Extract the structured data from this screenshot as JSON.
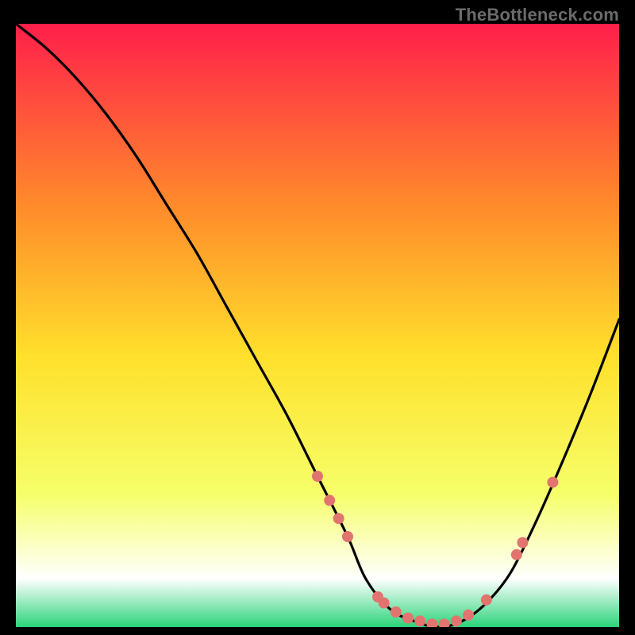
{
  "watermark": "TheBottleneck.com",
  "chart_data": {
    "type": "line",
    "title": "",
    "xlabel": "",
    "ylabel": "",
    "xlim": [
      0,
      100
    ],
    "ylim": [
      0,
      100
    ],
    "grid": false,
    "legend": false,
    "background_gradient": {
      "top": "#ff1f4b",
      "mid_upper": "#ff8a2b",
      "mid": "#ffe02b",
      "lower": "#f6ff6a",
      "near_bottom": "#ffffff",
      "bottom": "#2bd47a"
    },
    "series": [
      {
        "name": "bottleneck-curve",
        "stroke": "#000000",
        "x": [
          0,
          5,
          10,
          15,
          20,
          25,
          30,
          35,
          40,
          45,
          50,
          55,
          58,
          62,
          66,
          70,
          74,
          78,
          82,
          86,
          90,
          95,
          100
        ],
        "y": [
          100,
          96,
          91,
          85,
          78,
          70,
          62,
          53,
          44,
          35,
          25,
          15,
          8,
          3,
          1,
          0,
          1,
          4,
          9,
          17,
          26,
          38,
          51
        ]
      }
    ],
    "markers": {
      "name": "highlight-points",
      "color": "#e2746f",
      "radius": 7,
      "points": [
        {
          "x": 50,
          "y": 25
        },
        {
          "x": 52,
          "y": 21
        },
        {
          "x": 53.5,
          "y": 18
        },
        {
          "x": 55,
          "y": 15
        },
        {
          "x": 60,
          "y": 5
        },
        {
          "x": 61,
          "y": 4
        },
        {
          "x": 63,
          "y": 2.5
        },
        {
          "x": 65,
          "y": 1.5
        },
        {
          "x": 67,
          "y": 1
        },
        {
          "x": 69,
          "y": 0.5
        },
        {
          "x": 71,
          "y": 0.5
        },
        {
          "x": 73,
          "y": 1
        },
        {
          "x": 75,
          "y": 2
        },
        {
          "x": 78,
          "y": 4.5
        },
        {
          "x": 83,
          "y": 12
        },
        {
          "x": 84,
          "y": 14
        },
        {
          "x": 89,
          "y": 24
        }
      ]
    }
  }
}
